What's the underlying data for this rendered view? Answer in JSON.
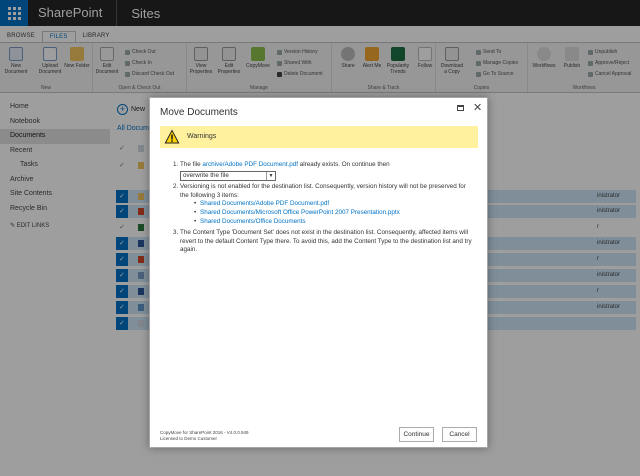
{
  "suitebar": {
    "brand": "SharePoint",
    "sites": "Sites"
  },
  "ribbon": {
    "tabs": [
      "BROWSE",
      "FILES",
      "LIBRARY"
    ],
    "groups": {
      "new": "New",
      "open_checkout": "Open & Check Out",
      "manage": "Manage",
      "share_track": "Share & Track",
      "copies": "Copies",
      "workflows": "Workflows"
    },
    "new_document": "New Document",
    "upload_document": "Upload Document",
    "new_folder": "New Folder",
    "edit_document": "Edit Document",
    "check_out": "Check Out",
    "check_in": "Check In",
    "discard_check_out": "Discard Check Out",
    "view_properties": "View Properties",
    "edit_properties": "Edit Properties",
    "copymove": "CopyMove",
    "version_history": "Version History",
    "shared_with": "Shared With",
    "delete_document": "Delete Document",
    "share": "Share",
    "alert_me": "Alert Me",
    "popularity_trends": "Popularity Trends",
    "follow": "Follow",
    "download_copy": "Download a Copy",
    "send_to": "Send To",
    "manage_copies": "Manage Copies",
    "go_to_source": "Go To Source",
    "workflows": "Workflows",
    "publish": "Publish",
    "unpublish": "Unpublish",
    "approve_reject": "Approve/Reject",
    "cancel_approval": "Cancel Approval"
  },
  "leftnav": {
    "items": [
      "Home",
      "Notebook",
      "Documents",
      "Recent",
      "Tasks",
      "Archive",
      "Site Contents",
      "Recycle Bin"
    ],
    "edit_links": "EDIT LINKS"
  },
  "library": {
    "new_label": "New",
    "all_docs": "All Docum",
    "rows": [
      {
        "selected": false,
        "who": ""
      },
      {
        "selected": false,
        "who": ""
      },
      {
        "selected": true,
        "who": "inistrator"
      },
      {
        "selected": true,
        "who": "inistrator"
      },
      {
        "selected": false,
        "who": "r"
      },
      {
        "selected": true,
        "who": "inistrator"
      },
      {
        "selected": true,
        "who": "r"
      },
      {
        "selected": true,
        "who": "inistrator"
      },
      {
        "selected": true,
        "who": "r"
      },
      {
        "selected": true,
        "who": "inistrator"
      },
      {
        "selected": true,
        "who": ""
      }
    ]
  },
  "dialog": {
    "title": "Move Documents",
    "warning_label": "Warnings",
    "item1_prefix": "The file ",
    "item1_link": "archive/Adobe PDF Document.pdf",
    "item1_suffix": " already exists. On continue then",
    "select_value": "overwrite the file",
    "item2_text": "Versioning is not enabled for the destination list. Consequently, version history will not be preserved for the following 3 items:",
    "item2_links": [
      "Shared Documents/Adobe PDF Document.pdf",
      "Shared Documents/Microsoft Office PowerPoint 2007 Presentation.pptx",
      "Shared Documents/Office Documents"
    ],
    "item3_text": "The Content Type 'Document Set' does not exist in the destination list. Consequently, affected items will revert to the default Content Type there. To avoid this, add the Content Type to the destination list and try again.",
    "footer_line1": "CopyMove for SharePoint 2016 - V4.0.0.949",
    "footer_line2": "Licensed to Demo Customer",
    "continue_label": "Continue",
    "cancel_label": "Cancel"
  },
  "colors": {
    "suite": "#262626",
    "accent": "#0072c6",
    "warning": "#fff19d"
  }
}
